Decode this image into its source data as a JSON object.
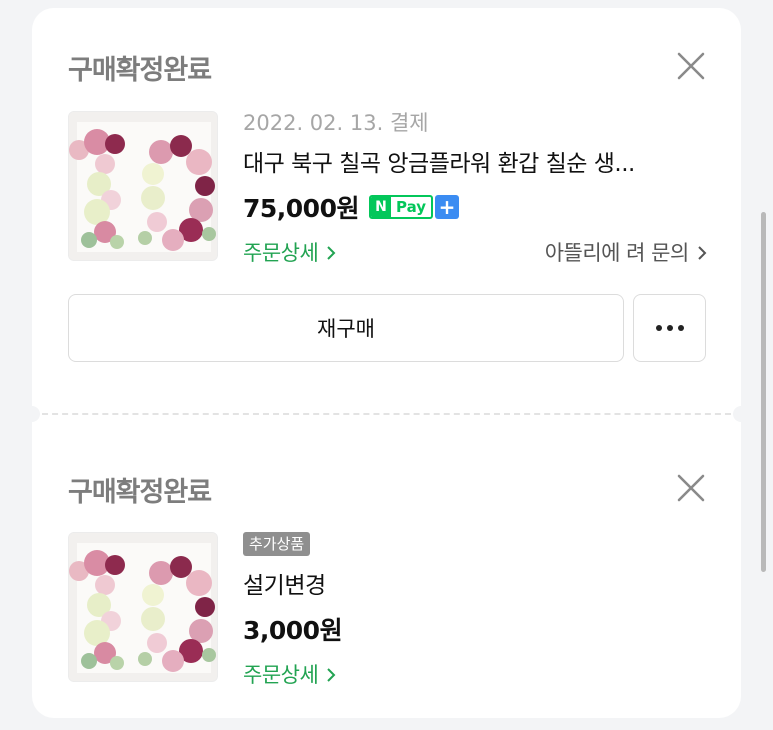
{
  "orders": [
    {
      "status": "구매확정완료",
      "date": "2022. 02. 13. 결제",
      "title": "대구 북구 칠곡 앙금플라워 환갑 칠순 생...",
      "price": "75,000원",
      "npay": {
        "n": "N",
        "pay": "Pay",
        "plus": "+"
      },
      "detail_link": "주문상세",
      "inquiry_link": "아뜰리에 려 문의",
      "rebuy_label": "재구매"
    },
    {
      "status": "구매확정완료",
      "badge": "추가상품",
      "title": "설기변경",
      "price": "3,000원",
      "detail_link": "주문상세"
    }
  ],
  "icons": {
    "close": "close-icon",
    "chevron": "chevron-right-icon",
    "more": "more-dots-icon"
  },
  "colors": {
    "status_text": "#7d7d7d",
    "link_green": "#22a352",
    "npay_green": "#03c75a",
    "plus_blue": "#3b8cf2",
    "badge_gray": "#8f8f8f"
  }
}
